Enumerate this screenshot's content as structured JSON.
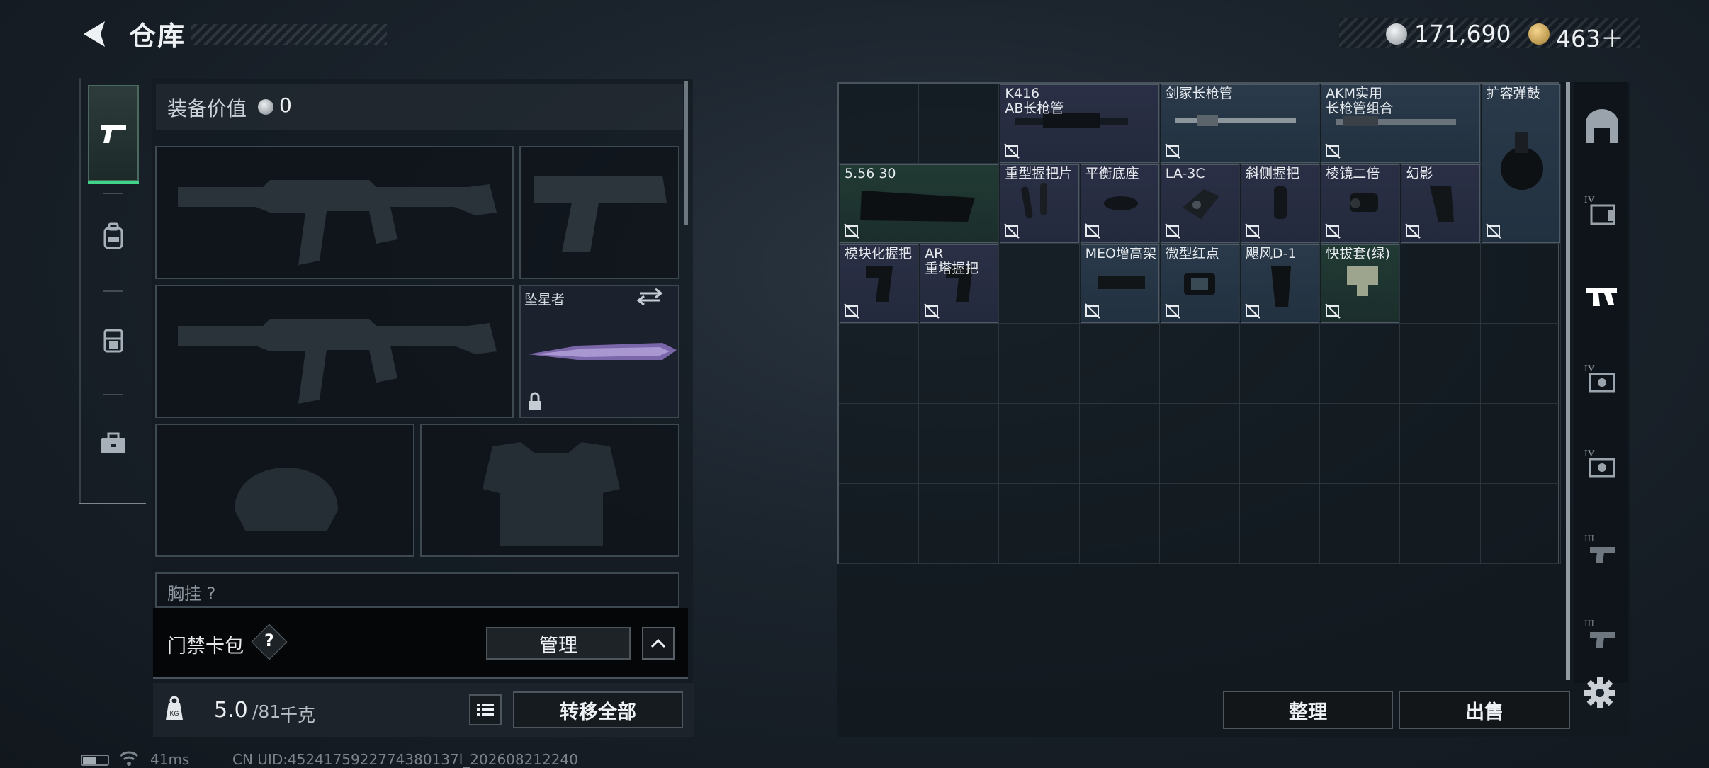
{
  "header": {
    "title": "仓库",
    "currency1_value": "171,690",
    "currency2_value": "463＋",
    "currency1_icon": "silver-coin-icon",
    "currency2_icon": "gold-coin-icon"
  },
  "left_tabs": [
    {
      "name": "pistol-icon",
      "active": true
    },
    {
      "name": "backpack-icon",
      "active": false
    },
    {
      "name": "chest-rig-icon",
      "active": false
    },
    {
      "name": "toolbox-icon",
      "active": false
    }
  ],
  "equipment": {
    "value_label": "装备价值",
    "value": "0",
    "melee_name": "坠星者",
    "chest_label": "胸挂 ?"
  },
  "card_pack": {
    "label": "门禁卡包",
    "help": "?",
    "manage_label": "管理"
  },
  "weight": {
    "current": "5.0",
    "max": "/81",
    "unit": "千克",
    "transfer_label": "转移全部"
  },
  "storage": {
    "columns": 9,
    "rows": 6,
    "items": [
      {
        "name": "K416\nAB长枪管",
        "color": "purple"
      },
      {
        "name": "剑冢长枪管",
        "color": "blue"
      },
      {
        "name": "AKM实用\n长枪管组合",
        "color": "blue"
      },
      {
        "name": "扩容弹鼓",
        "color": "blue"
      },
      {
        "name": "5.56 30",
        "color": "green"
      },
      {
        "name": "重型握把片",
        "color": "purple"
      },
      {
        "name": "平衡底座",
        "color": "purple"
      },
      {
        "name": "LA-3C",
        "color": "purple"
      },
      {
        "name": "斜侧握把",
        "color": "purple"
      },
      {
        "name": "棱镜二倍",
        "color": "purple"
      },
      {
        "name": "幻影",
        "color": "purple"
      },
      {
        "name": "模块化握把",
        "color": "purple"
      },
      {
        "name": "AR\n重塔握把",
        "color": "purple"
      },
      {
        "name": "MEO增高架",
        "color": "blue"
      },
      {
        "name": "微型红点",
        "color": "blue"
      },
      {
        "name": "飓风D-1",
        "color": "blue"
      },
      {
        "name": "快拔套(绿)",
        "color": "green"
      }
    ]
  },
  "actions": {
    "sort_label": "整理",
    "sell_label": "出售"
  },
  "right_tabs": [
    "home-icon",
    "iv-bag-icon",
    "rifle-icon",
    "iv-camera-icon",
    "iv-camera-icon-2",
    "iii-gun-icon",
    "iii-gun-icon-2"
  ],
  "status": {
    "ping": "41ms",
    "uid": "CN UID:4524175922774380137l_202608212240"
  },
  "colors": {
    "accent_green": "#3fd38a",
    "rarity_purple": "#2a2f45",
    "rarity_blue": "#2a3a4a",
    "rarity_green": "#213a34"
  }
}
